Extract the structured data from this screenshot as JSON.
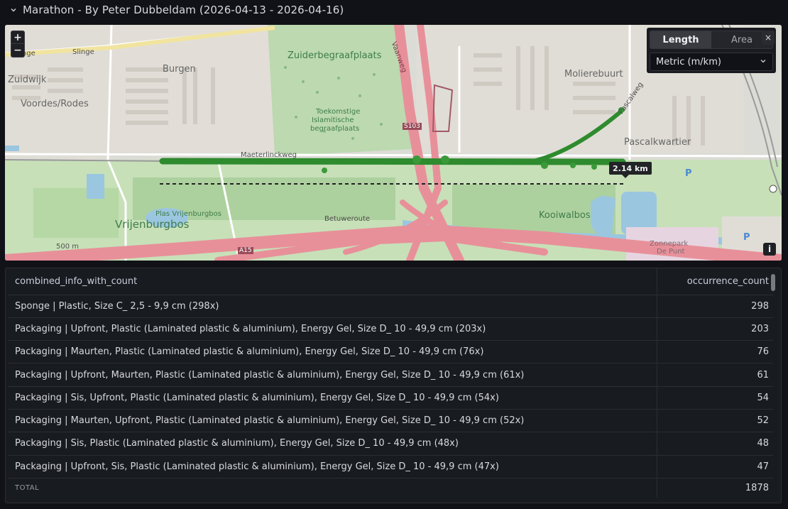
{
  "panel": {
    "title": "Marathon - By Peter Dubbeldam (2026-04-13 - 2026-04-16)"
  },
  "map": {
    "zoom_in": "+",
    "zoom_out": "−",
    "measure": {
      "tab_length": "Length",
      "tab_area": "Area",
      "unit": "Metric (m/km)"
    },
    "close": "×",
    "info": "i",
    "distance_label": "2.14 km",
    "labels": {
      "slinge": "Slinge",
      "slinge2": "Slinge",
      "zuidwijk": "Zuidwijk",
      "burgen": "Burgen",
      "voordes": "Voordes/Rodes",
      "zuiderbegraafplaats": "Zuiderbegraafplaats",
      "toekomstige": "Toekomstige",
      "islamitische": "Islamitische",
      "begraafplaats": "begraafplaats",
      "molierebuurt": "Molierebuurt",
      "pascalweg": "Pascalweg",
      "pascalkwartier": "Pascalkwartier",
      "maeterlinckweg": "Maeterlinckweg",
      "betuweroute": "Betuweroute",
      "kooiwalbos": "Kooiwalbos",
      "plas_vrijenburgbos": "Plas Vrijenburgbos",
      "vrijenburgbos": "Vrijenburgbos",
      "a15": "A15",
      "s103": "S103",
      "vaanweg": "Vaanweg",
      "zonnepark": "Zonnepark",
      "de_punt": "De Punt",
      "scale": "500 m"
    },
    "colors": {
      "track": "#2e8b2e",
      "highway": "#e8909a",
      "water": "#9bc6e0",
      "park": "#add19e"
    }
  },
  "table": {
    "columns": [
      "combined_info_with_count",
      "occurrence_count"
    ],
    "rows": [
      {
        "info": "Sponge | Plastic, Size C_ 2,5 - 9,9 cm (298x)",
        "count": "298"
      },
      {
        "info": "Packaging | Upfront, Plastic (Laminated plastic & aluminium), Energy Gel, Size D_ 10 - 49,9 cm (203x)",
        "count": "203"
      },
      {
        "info": "Packaging | Maurten, Plastic (Laminated plastic & aluminium), Energy Gel, Size D_ 10 - 49,9 cm (76x)",
        "count": "76"
      },
      {
        "info": "Packaging | Upfront, Maurten, Plastic (Laminated plastic & aluminium), Energy Gel, Size D_ 10 - 49,9 cm (61x)",
        "count": "61"
      },
      {
        "info": "Packaging | Sis, Upfront, Plastic (Laminated plastic & aluminium), Energy Gel, Size D_ 10 - 49,9 cm (54x)",
        "count": "54"
      },
      {
        "info": "Packaging | Maurten, Upfront, Plastic (Laminated plastic & aluminium), Energy Gel, Size D_ 10 - 49,9 cm (52x)",
        "count": "52"
      },
      {
        "info": "Packaging | Sis, Plastic (Laminated plastic & aluminium), Energy Gel, Size D_ 10 - 49,9 cm (48x)",
        "count": "48"
      },
      {
        "info": "Packaging | Upfront, Sis, Plastic (Laminated plastic & aluminium), Energy Gel, Size D_ 10 - 49,9 cm (47x)",
        "count": "47"
      }
    ],
    "total_label": "TOTAL",
    "total_value": "1878"
  }
}
